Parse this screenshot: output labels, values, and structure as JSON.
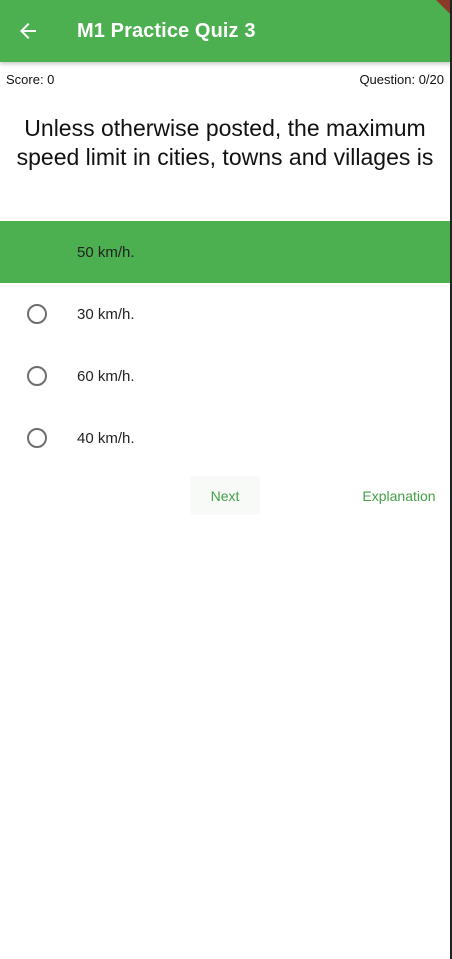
{
  "app_bar": {
    "title": "M1 Practice Quiz 3",
    "back_icon": "arrow-left-icon",
    "color": "#4caf50"
  },
  "status": {
    "score": "Score: 0",
    "question": "Question: 0/20"
  },
  "question": {
    "text": "Unless otherwise posted, the maximum speed limit in cities, towns and villages is"
  },
  "options": [
    {
      "label": "50 km/h.",
      "selected": true
    },
    {
      "label": "30 km/h.",
      "selected": false
    },
    {
      "label": "60 km/h.",
      "selected": false
    },
    {
      "label": "40 km/h.",
      "selected": false
    }
  ],
  "actions": {
    "next_label": "Next",
    "explanation_label": "Explanation"
  },
  "colors": {
    "accent": "#4caf50",
    "action_text": "#43a047"
  }
}
